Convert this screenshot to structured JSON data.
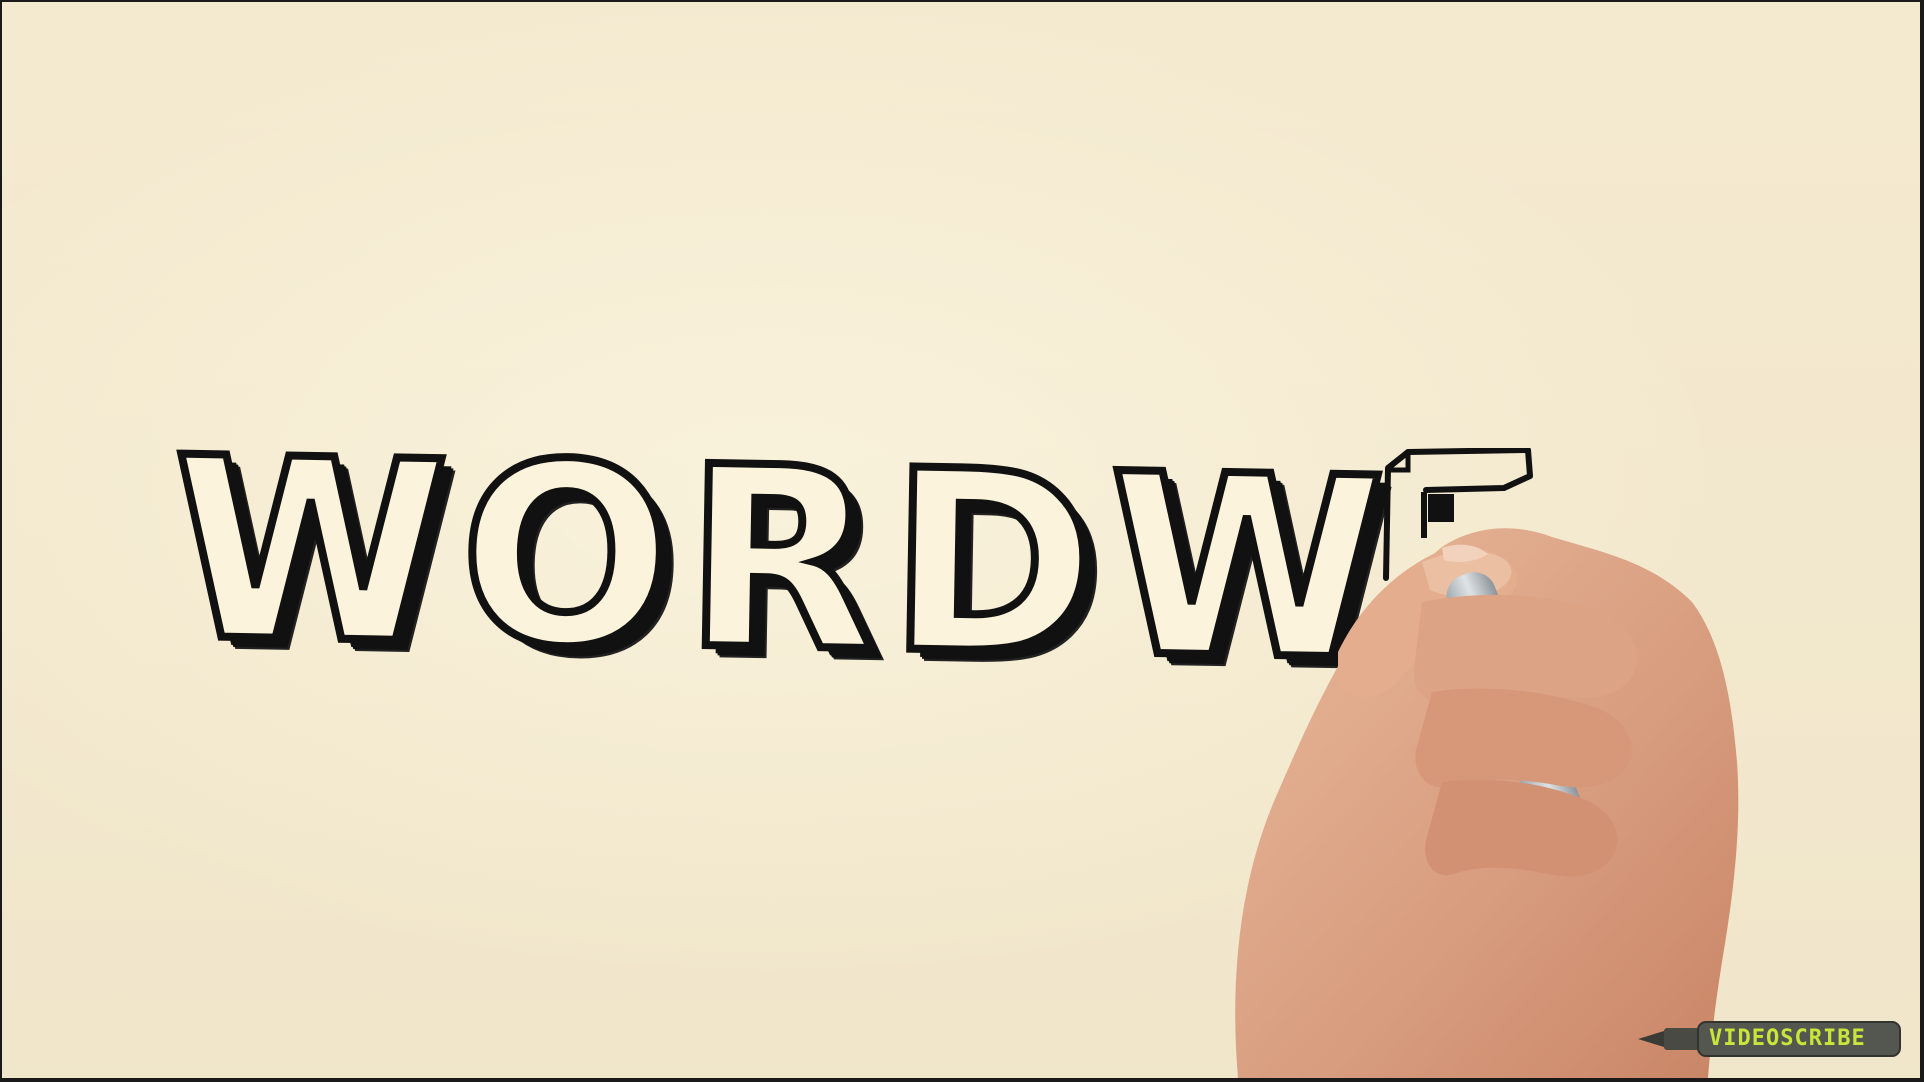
{
  "canvas": {
    "background_color": "#f4ead0",
    "ink_color": "#111111"
  },
  "drawing": {
    "word": "WORDW"
  },
  "hand": {
    "icon": "hand-holding-marker-icon"
  },
  "badge": {
    "label": "VIDEOSCRIBE",
    "icon": "marker-pen-icon",
    "text_color": "#c7e63a"
  }
}
